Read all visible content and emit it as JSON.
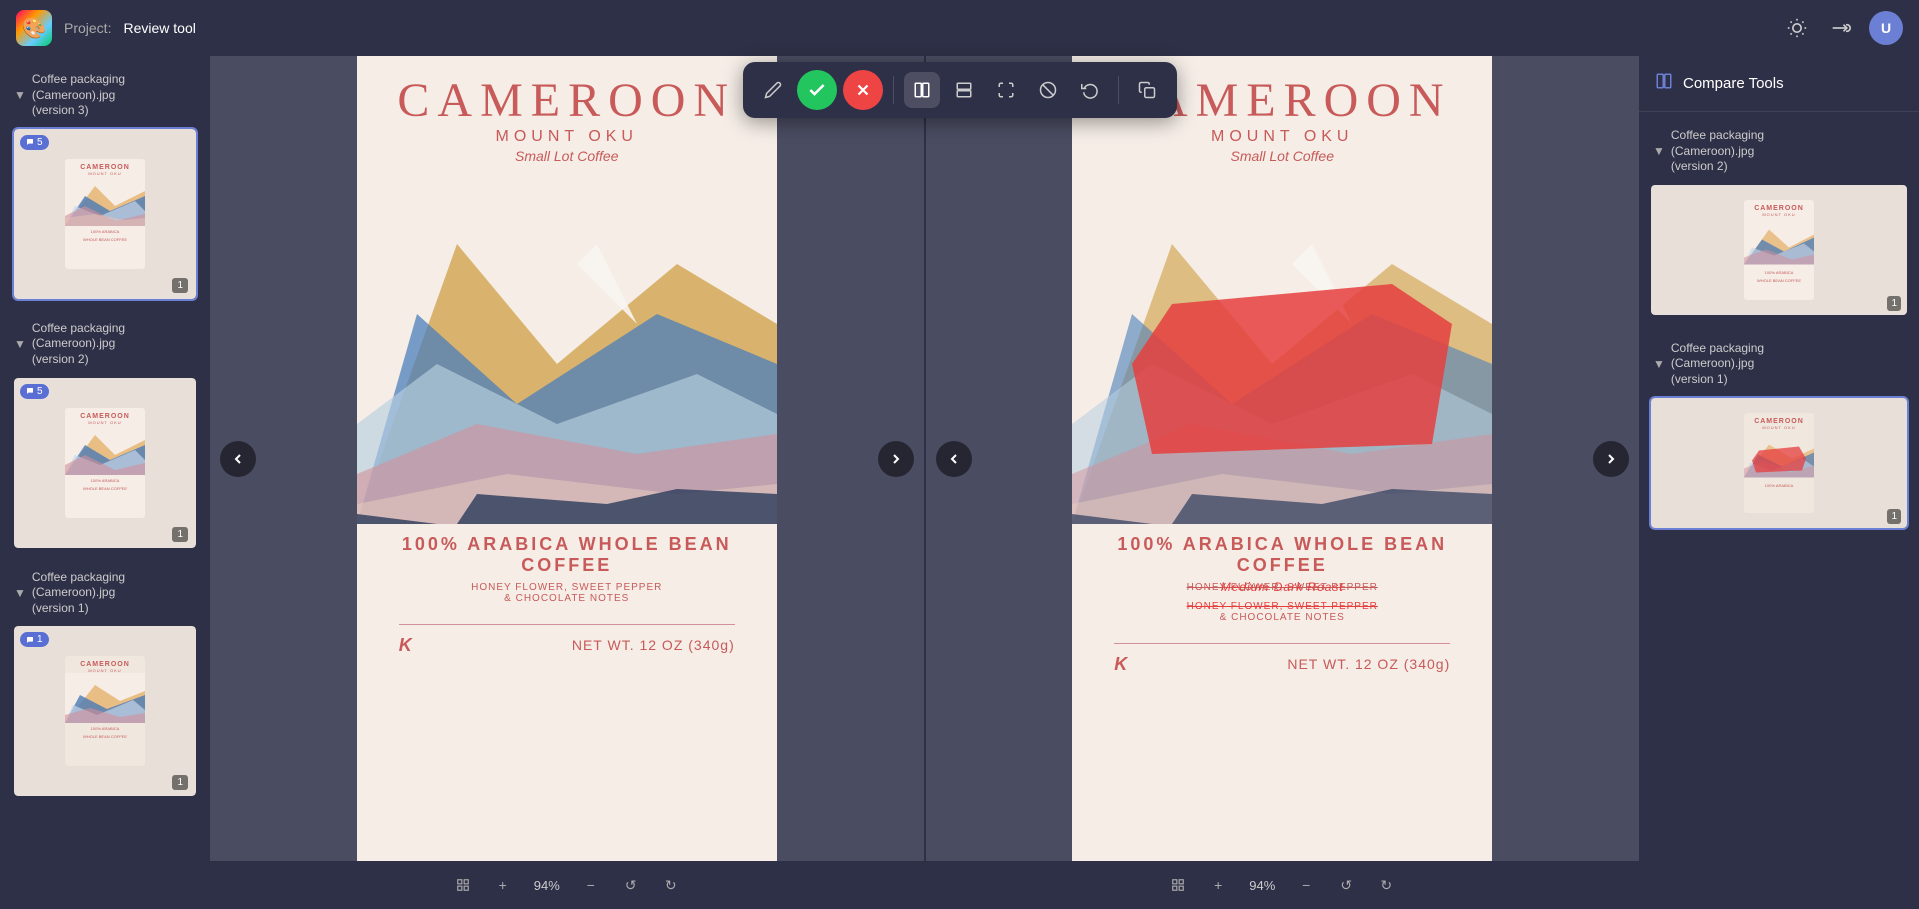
{
  "topbar": {
    "logo_emoji": "🎨",
    "project_label": "Project:",
    "project_name": "Review tool",
    "title": "Review tool"
  },
  "annotation_toolbar": {
    "pencil_label": "✏",
    "confirm_label": "✓",
    "cancel_label": "✕",
    "split_v_label": "⊞",
    "split_h_label": "⊟",
    "expand_label": "↔",
    "mask_label": "◉",
    "refresh_label": "↺",
    "copy_label": "⧉"
  },
  "sidebar": {
    "groups": [
      {
        "title_line1": "Coffee packaging",
        "title_line2": "(Cameroon).jpg",
        "title_line3": "(version 3)",
        "comment_count": "5",
        "page_num": "1",
        "selected": true
      },
      {
        "title_line1": "Coffee packaging",
        "title_line2": "(Cameroon).jpg",
        "title_line3": "(version 2)",
        "comment_count": "5",
        "page_num": "1",
        "selected": false
      },
      {
        "title_line1": "Coffee packaging",
        "title_line2": "(Cameroon).jpg",
        "title_line3": "(version 1)",
        "comment_count": "1",
        "page_num": "1",
        "selected": false
      }
    ]
  },
  "viewer_left": {
    "zoom": "94%",
    "package": {
      "title": "CAMEROON",
      "subtitle": "MOUNT OKU",
      "script": "Small Lot Coffee",
      "main_text": "100% ARABICA WHOLE BEAN COFFEE",
      "sub_text1": "HONEY FLOWER, SWEET PEPPER",
      "sub_text2": "& CHOCOLATE NOTES",
      "weight": "NET WT. 12 OZ (340g)"
    }
  },
  "viewer_right": {
    "zoom": "94%",
    "package": {
      "title": "CAMEROON",
      "subtitle": "MOUNT OKU",
      "script": "Small Lot Coffee",
      "main_text": "100% ARABICA WHOLE BEAN COFFEE",
      "sub_text1_strike": "HONEY FLOWER, SWEET PEPPER",
      "sub_text2_overlay": "Medium Dark Roast",
      "sub_text3_strike": "HONEY FLOWER, SWEET PEPPER",
      "sub_text2": "& CHOCOLATE NOTES",
      "weight": "NET WT. 12 OZ (340g)"
    }
  },
  "right_panel": {
    "title": "Compare Tools",
    "icon": "⊞",
    "groups": [
      {
        "title_line1": "Coffee packaging",
        "title_line2": "(Cameroon).jpg",
        "title_line3": "(version 2)",
        "page_num": "1"
      },
      {
        "title_line1": "Coffee packaging",
        "title_line2": "(Cameroon).jpg",
        "title_line3": "(version 1)",
        "page_num": "1",
        "selected": true
      }
    ]
  },
  "toolbar_buttons": {
    "zoom_in": "+",
    "zoom_out": "−",
    "rotate_left": "↺",
    "rotate_right": "↻",
    "fit": "⊡"
  }
}
